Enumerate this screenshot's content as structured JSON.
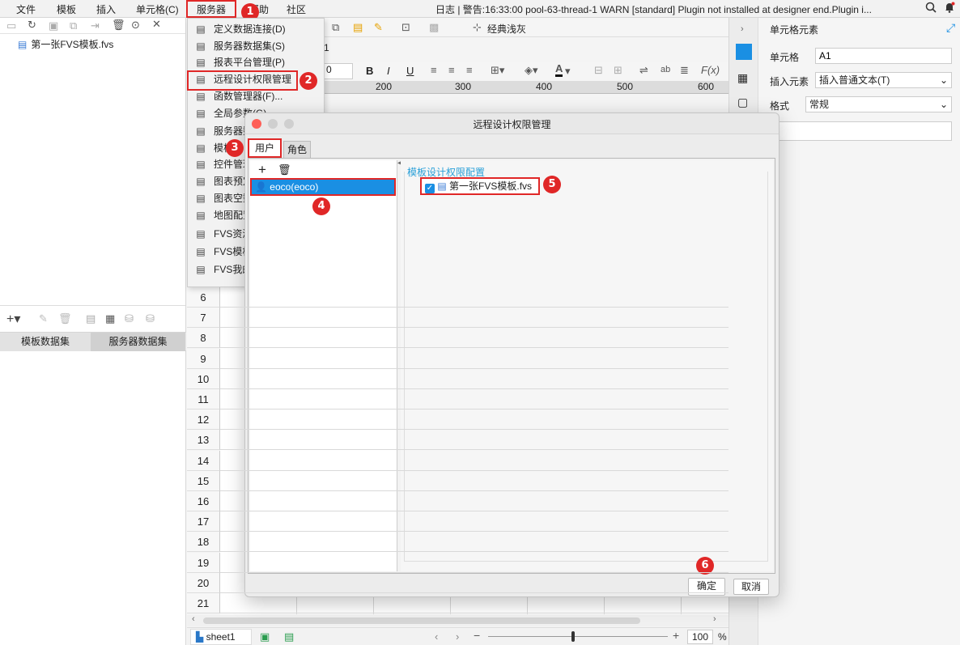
{
  "menubar": {
    "items": [
      "文件",
      "模板",
      "插入",
      "单元格(C)",
      "服务器",
      "帮助",
      "社区"
    ],
    "status_log": "日志 | 警告:16:33:00 pool-63-thread-1 WARN [standard] Plugin not installed at designer end.Plugin i..."
  },
  "left_panel": {
    "file_name": "第一张FVS模板.fvs",
    "tabs": [
      "模板数据集",
      "服务器数据集"
    ]
  },
  "server_menu": {
    "items": [
      {
        "label": "定义数据连接(D)",
        "icon": "database-connection-icon"
      },
      {
        "label": "服务器数据集(S)",
        "icon": "server-dataset-icon"
      },
      {
        "label": "报表平台管理(P)",
        "icon": "user-icon"
      },
      {
        "label": "远程设计权限管理",
        "icon": "user-lock-icon"
      },
      {
        "label": "函数管理器(F)...",
        "icon": "function-icon"
      },
      {
        "label": "全局参数(G)",
        "icon": "parameter-icon"
      },
      {
        "label": "服务器数据",
        "icon": "server-data-icon"
      },
      {
        "label": "模板",
        "icon": "shirt-icon"
      },
      {
        "label": "控件管理",
        "icon": "widget-icon"
      },
      {
        "label": "图表预定",
        "icon": "bar-chart-icon"
      },
      {
        "label": "图表空数据",
        "icon": "chart-empty-icon"
      },
      {
        "label": "地图配置",
        "icon": "map-icon"
      },
      {
        "label": "FVS资源",
        "icon": "fvs-resource-icon"
      },
      {
        "label": "FVS模板",
        "icon": "fvs-template-icon"
      },
      {
        "label": "FVS我的",
        "icon": "fvs-mine-icon"
      }
    ]
  },
  "toolbar": {
    "theme": "经典浅灰",
    "font_size": "0",
    "sheet_tab": "1",
    "ruler": [
      "200",
      "300",
      "400",
      "500",
      "600"
    ]
  },
  "grid": {
    "rows": [
      "6",
      "7",
      "8",
      "9",
      "10",
      "11",
      "12",
      "13",
      "14",
      "15",
      "16",
      "17",
      "18",
      "19",
      "20",
      "21"
    ]
  },
  "bottom_bar": {
    "sheet": "sheet1",
    "zoom": "100",
    "zoom_unit": "%"
  },
  "right_panel": {
    "title": "单元格元素",
    "cell_label": "单元格",
    "cell_value": "A1",
    "insert_label": "插入元素",
    "insert_value": "插入普通文本(T)",
    "format_label": "格式",
    "format_value": "常规"
  },
  "dialog": {
    "title": "远程设计权限管理",
    "tabs": [
      "用户",
      "角色"
    ],
    "user": "eoco(eoco)",
    "config_title": "模板设计权限配置",
    "template": "第一张FVS模板.fvs",
    "ok": "确定",
    "cancel": "取消"
  },
  "annotations": [
    "1",
    "2",
    "3",
    "4",
    "5",
    "6"
  ],
  "colors": {
    "accent": "#e02727",
    "selection": "#1a8fe3",
    "link": "#2aa0d8"
  }
}
